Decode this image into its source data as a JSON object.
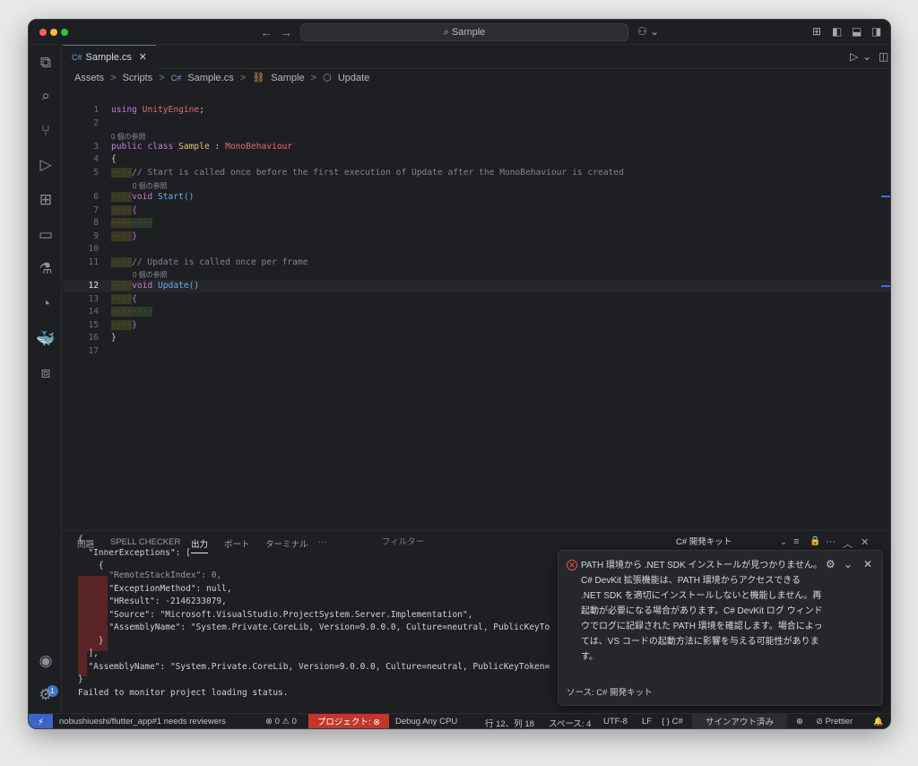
{
  "titlebar": {
    "search": "Sample",
    "back": "←",
    "forward": "→",
    "copilot": "⚇ ⌄"
  },
  "activity": {
    "badge": "1"
  },
  "tab": {
    "label": "Sample.cs",
    "close": "✕",
    "icon": "C#"
  },
  "editor_actions": {
    "run": "▷",
    "run_menu": "⌄",
    "split": "◫",
    "more": "···"
  },
  "breadcrumb": [
    "Assets",
    "Scripts",
    "Sample.cs",
    "Sample",
    "Update"
  ],
  "breadcrumb_sep": ">",
  "code": {
    "line_numbers": [
      "1",
      "2",
      "3",
      "4",
      "5",
      "6",
      "7",
      "8",
      "9",
      "10",
      "11",
      "12",
      "13",
      "14",
      "15",
      "16",
      "17"
    ],
    "ref_lens": "0 個の参照",
    "l1_kw": "using",
    "l1_ns": "UnityEngine",
    "l1_semi": ";",
    "l3_public": "public",
    "l3_class": "class",
    "l3_name": "Sample",
    "l3_colon": ":",
    "l3_base": "MonoBehaviour",
    "open_brace": "{",
    "close_brace": "}",
    "l5_comment": "// Start is called once before the first execution of Update after the MonoBehaviour is created",
    "void": "void",
    "start_fn": "Start",
    "update_fn": "Update",
    "parens": "()",
    "l11_comment": "// Update is called once per frame",
    "indent": "····"
  },
  "panel": {
    "tabs": [
      "問題",
      "SPELL CHECKER",
      "出力",
      "ポート",
      "ターミナル",
      "···"
    ],
    "filter_placeholder": "フィルター",
    "channel": "C# 開発キット",
    "channel_chev": "⌄",
    "actions": [
      "≡",
      "🔒",
      "···",
      "︿",
      "✕"
    ],
    "output_lines": [
      "{",
      "  \"InnerExceptions\": [",
      "    {",
      "      \"RemoteStackIndex\": 0,",
      "      \"ExceptionMethod\": null,",
      "      \"HResult\": -2146233079,",
      "      \"Source\": \"Microsoft.VisualStudio.ProjectSystem.Server.Implementation\",",
      "      \"AssemblyName\": \"System.Private.CoreLib, Version=9.0.0.0, Culture=neutral, PublicKeyTo",
      "    }",
      "  ],",
      "  \"AssemblyName\": \"System.Private.CoreLib, Version=9.0.0.0, Culture=neutral, PublicKeyToken=",
      "}",
      "Failed to monitor project loading status."
    ]
  },
  "toast": {
    "message": "PATH 環境から .NET SDK インストールが見つかりません。C# DevKit 拡張機能は、PATH 環境からアクセスできる .NET SDK を適切にインストールしないと機能しません。再起動が必要になる場合があります。C# DevKit ログ ウィンドウでログに記録された PATH 環境を確認します。場合によっては、VS コードの起動方法に影響を与える可能性があります。",
    "source": "ソース: C# 開発キット",
    "gear": "⚙",
    "collapse": "⌄",
    "close": "✕",
    "err": "✕"
  },
  "statusbar": {
    "remote": "⚡",
    "pr": "nobushiueshi/flutter_app#1 needs reviewers",
    "problems": "⊗ 0 ⚠ 0",
    "project": "プロジェクト: ⊗",
    "debug": "Debug Any CPU",
    "position": "行 12、列 18",
    "spaces": "スペース: 4",
    "encoding": "UTF-8",
    "eol": "LF",
    "language": "{ } C#",
    "signin": "サインアウト済み",
    "copilot": "⊕",
    "prettier": "⊘ Prettier",
    "bell": "🔔"
  }
}
